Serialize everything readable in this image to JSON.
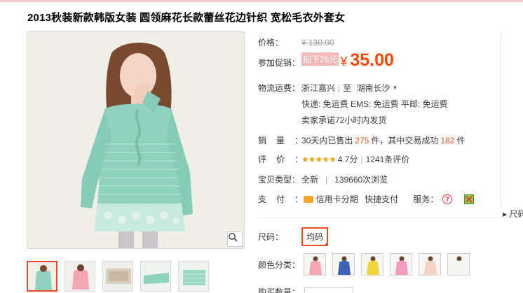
{
  "title": "2013秋装新款韩版女装 圆领麻花长款蕾丝花边针织 宽松毛衣外套女",
  "price": {
    "label": "价格：",
    "original": "¥ 130.00"
  },
  "promo": {
    "label": "参加促销：",
    "tag": "拍下26元",
    "currency": "¥",
    "amount": "35.00"
  },
  "shipping": {
    "label": "物流运费：",
    "from": "浙江嘉兴",
    "to_prefix": "至",
    "to": "湖南长沙",
    "line2": "快递: 免运费   EMS: 免运费   平邮: 免运费",
    "line3": "卖家承诺72小时内发货"
  },
  "sales": {
    "label": "销量：",
    "prefix": "30天内已售出",
    "sold": "275",
    "mid": "件，其中交易成功",
    "success": "182",
    "suffix": "件"
  },
  "rating": {
    "label": "评价：",
    "stars": "★★★★★",
    "score": "4.7分",
    "reviews": "1241条评价"
  },
  "item_type": {
    "label": "宝贝类型：",
    "condition": "全新",
    "views": "139660次浏览"
  },
  "payment": {
    "label": "支付：",
    "credit": "信用卡分期",
    "quick": "快捷支付",
    "service_label": "服务："
  },
  "side_size": "尺码",
  "size": {
    "label": "尺码：",
    "value": "均码"
  },
  "color": {
    "label": "颜色分类：",
    "swatches": [
      "#f2a7b2",
      "#3a63b8",
      "#f3d43a",
      "#f29ac0",
      "#f4d3c2",
      "#f4f4f2"
    ]
  },
  "quantity": {
    "label": "购买数量："
  }
}
